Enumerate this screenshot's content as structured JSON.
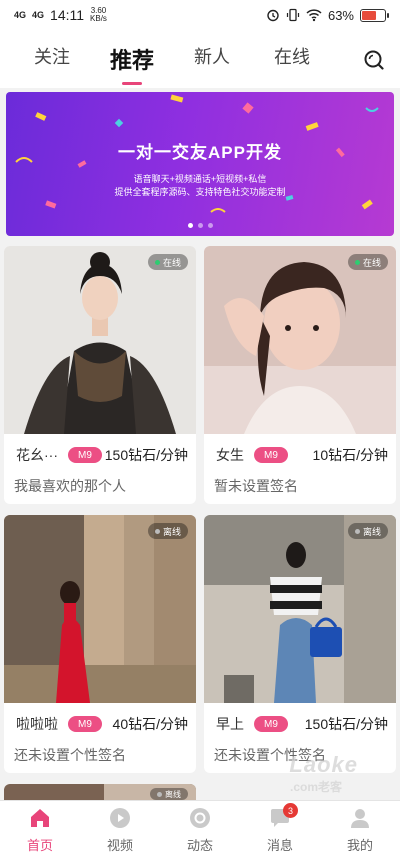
{
  "status_bar": {
    "network_1": "4G",
    "network_2": "4G",
    "time": "14:11",
    "speed": "3.60",
    "speed_unit": "KB/s",
    "battery_text": "63%",
    "battery_level": 0.63
  },
  "nav": {
    "tabs": [
      {
        "label": "关注"
      },
      {
        "label": "推荐"
      },
      {
        "label": "新人"
      },
      {
        "label": "在线"
      }
    ],
    "active_tab": "推荐"
  },
  "banner": {
    "title": "一对一交友APP开发",
    "line1": "语音聊天+视频通话+短视频+私信",
    "line2": "提供全套程序源码、支持特色社交功能定制",
    "slides": 3,
    "active_slide": 1
  },
  "cards": [
    {
      "name": "花幺···",
      "level": "M9",
      "price": "150钻石/分钟",
      "signature": "我最喜欢的那个人",
      "status": "在线",
      "status_color": "#2ecc71"
    },
    {
      "name": "女生",
      "level": "M9",
      "price": "10钻石/分钟",
      "signature": "暂未设置签名",
      "status": "在线",
      "status_color": "#2ecc71"
    },
    {
      "name": "啦啦啦",
      "level": "M9",
      "price": "40钻石/分钟",
      "signature": "还未设置个性签名",
      "status": "离线",
      "status_color": "#bbbbbb"
    },
    {
      "name": "早上",
      "level": "M9",
      "price": "150钻石/分钟",
      "signature": "还未设置个性签名",
      "status": "离线",
      "status_color": "#bbbbbb"
    },
    {
      "status": "离线",
      "status_color": "#bbbbbb"
    }
  ],
  "tab_bar": {
    "items": [
      {
        "label": "首页",
        "icon": "home-icon"
      },
      {
        "label": "视频",
        "icon": "video-icon"
      },
      {
        "label": "动态",
        "icon": "moments-icon"
      },
      {
        "label": "消息",
        "icon": "message-icon",
        "badge": "3"
      },
      {
        "label": "我的",
        "icon": "profile-icon"
      }
    ],
    "active": "首页"
  },
  "watermark": {
    "text": "Laoke",
    "sub": ".com老客"
  },
  "colors": {
    "accent": "#e8457a",
    "level_badge": "#ec4f84",
    "banner_start": "#6b2bd9",
    "banner_end": "#b63ad2"
  }
}
